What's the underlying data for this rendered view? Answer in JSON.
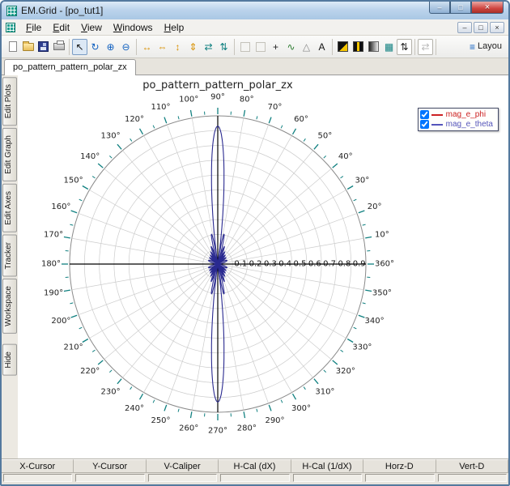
{
  "window": {
    "title": "EM.Grid - [po_tut1]",
    "controls": {
      "minimize": "–",
      "maximize": "□",
      "close": "×"
    }
  },
  "menu": {
    "items": [
      "File",
      "Edit",
      "View",
      "Windows",
      "Help"
    ],
    "mdi_controls": {
      "minimize": "–",
      "restore": "□",
      "close": "×"
    }
  },
  "toolbar": {
    "layout_label": "Layou",
    "buttons": [
      {
        "name": "new-file",
        "type": "css",
        "cls": "ic-page"
      },
      {
        "name": "open",
        "type": "css",
        "cls": "ic-folder"
      },
      {
        "name": "save",
        "type": "css",
        "cls": "ic-floppy"
      },
      {
        "name": "print",
        "type": "css",
        "cls": "ic-printer"
      },
      {
        "type": "sep"
      },
      {
        "name": "pointer-tool",
        "type": "glyph",
        "glyph": "↖",
        "color": "#111",
        "selected": true
      },
      {
        "name": "refresh",
        "type": "glyph",
        "glyph": "↻",
        "color": "#1060c0"
      },
      {
        "name": "zoom-in",
        "type": "glyph",
        "glyph": "⊕",
        "color": "#1060c0"
      },
      {
        "name": "zoom-out",
        "type": "glyph",
        "glyph": "⊖",
        "color": "#1060c0"
      },
      {
        "type": "sep"
      },
      {
        "name": "expand-horizontal",
        "type": "glyph",
        "glyph": "↔",
        "color": "#d89000"
      },
      {
        "name": "fit-horizontal",
        "type": "glyph",
        "glyph": "⇔",
        "color": "#d89000"
      },
      {
        "name": "expand-vertical",
        "type": "glyph",
        "glyph": "↕",
        "color": "#d89000"
      },
      {
        "name": "fit-vertical",
        "type": "glyph",
        "glyph": "⇕",
        "color": "#d89000"
      },
      {
        "name": "autoscale-x",
        "type": "glyph",
        "glyph": "⇄",
        "color": "#0f8080"
      },
      {
        "name": "autoscale-y",
        "type": "glyph",
        "glyph": "⇅",
        "color": "#0f8080"
      },
      {
        "type": "sep"
      },
      {
        "name": "option-box-1",
        "type": "css",
        "cls": "ic-box-light"
      },
      {
        "name": "option-box-2",
        "type": "css",
        "cls": "ic-box-light"
      },
      {
        "name": "add-marker",
        "type": "glyph",
        "glyph": "+",
        "color": "#222"
      },
      {
        "name": "spline-tool",
        "type": "glyph",
        "glyph": "∿",
        "color": "#2e7d32"
      },
      {
        "name": "triangle-marker",
        "type": "glyph",
        "glyph": "△",
        "color": "#888"
      },
      {
        "name": "text-tool",
        "type": "glyph",
        "glyph": "A",
        "color": "#111"
      },
      {
        "type": "sep"
      },
      {
        "name": "palette-dark-1",
        "type": "css",
        "cls": "ic-swatch1"
      },
      {
        "name": "palette-dark-2",
        "type": "css",
        "cls": "ic-swatch2"
      },
      {
        "name": "palette-gradient",
        "type": "css",
        "cls": "ic-gradient"
      },
      {
        "name": "grid-toggle",
        "type": "glyph",
        "glyph": "▦",
        "color": "#0f8080"
      },
      {
        "name": "axis-stepper",
        "type": "glyph",
        "glyph": "⇅",
        "color": "#222",
        "boxed": true
      },
      {
        "type": "sep"
      },
      {
        "name": "pan-tool",
        "type": "glyph",
        "glyph": "⇄",
        "color": "#bbb",
        "boxed": true
      },
      {
        "type": "sep"
      },
      {
        "name": "layout",
        "type": "layout",
        "glyph": "≡",
        "color": "#1060c0"
      }
    ]
  },
  "tabs": [
    {
      "label": "po_pattern_pattern_polar_zx",
      "active": true
    }
  ],
  "sidebar": {
    "items": [
      "Edit Plots",
      "Edit Graph",
      "Edit Axes",
      "Tracker",
      "Workspace",
      "Hide"
    ]
  },
  "statusbar": {
    "headers": [
      "X-Cursor",
      "Y-Cursor",
      "V-Caliper",
      "H-Cal (dX)",
      "H-Cal (1/dX)",
      "Horz-D",
      "Vert-D"
    ],
    "values": [
      "",
      "",
      "",
      "",
      "",
      "",
      ""
    ]
  },
  "chart_data": {
    "type": "polar-line",
    "title": "po_pattern_pattern_polar_zx",
    "angle_grid_step_deg": 10,
    "angle_labels_deg": [
      10,
      20,
      30,
      40,
      50,
      60,
      70,
      80,
      90,
      100,
      110,
      120,
      130,
      140,
      150,
      160,
      170,
      180,
      190,
      200,
      210,
      220,
      230,
      240,
      250,
      260,
      270,
      280,
      290,
      300,
      310,
      320,
      330,
      340,
      350,
      360
    ],
    "radial_ticks": [
      0.1,
      0.2,
      0.3,
      0.4,
      0.5,
      0.6,
      0.7,
      0.8,
      0.9
    ],
    "rmax": 1.0,
    "grid": true,
    "tick_color": "#108080",
    "grid_color": "#cccccc",
    "axis_color": "#000000",
    "legend": {
      "position": "top-right",
      "entries": [
        {
          "label": "mag_e_phi",
          "color": "#cc2222",
          "checked": true
        },
        {
          "label": "mag_e_theta",
          "color": "#5555bb",
          "checked": true
        }
      ]
    },
    "series": [
      {
        "name": "mag_e_phi",
        "color": "#cc2222",
        "model": {
          "type": "constant",
          "value": 0.004
        }
      },
      {
        "name": "mag_e_theta",
        "color": "#2a2a90",
        "model": {
          "type": "uniform_line_array",
          "elements": 14,
          "peak": 0.93,
          "main_lobe_deg": [
            90,
            270
          ]
        },
        "key_points": [
          {
            "angle_deg": 90,
            "r": 0.93
          },
          {
            "angle_deg": 270,
            "r": 0.93
          },
          {
            "angle_deg": 0,
            "r": 0.0
          },
          {
            "angle_deg": 180,
            "r": 0.0
          },
          {
            "angle_deg": 78,
            "r": 0.2
          },
          {
            "angle_deg": 102,
            "r": 0.2
          }
        ]
      }
    ]
  }
}
